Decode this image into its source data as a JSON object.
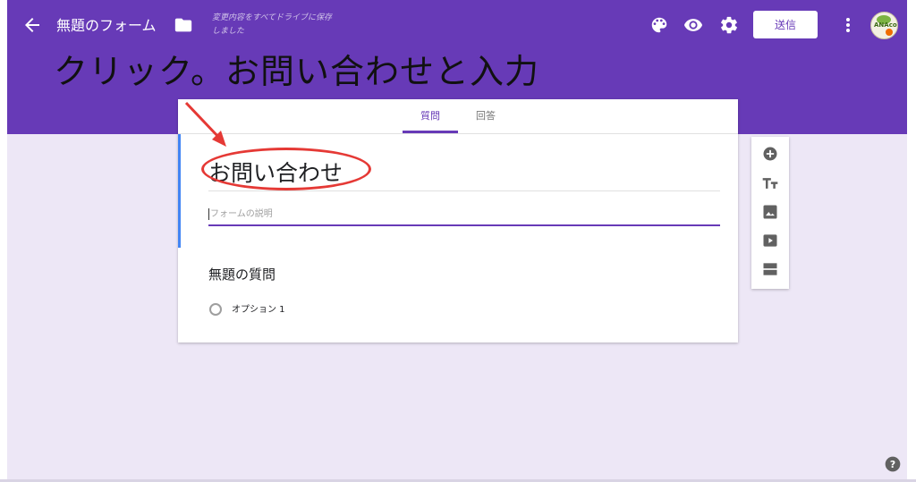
{
  "header": {
    "form_title": "無題のフォーム",
    "save_status": "変更内容をすべてドライブに保存しました",
    "send_label": "送信",
    "annotation": "クリック。お問い合わせと入力",
    "avatar_text": "ANAco"
  },
  "tabs": {
    "questions": "質問",
    "answers": "回答"
  },
  "form": {
    "title": "お問い合わせ",
    "description_placeholder": "フォームの説明"
  },
  "question": {
    "title": "無題の質問",
    "option1": "オプション 1"
  },
  "toolbar": {
    "items": [
      "add-question-icon",
      "add-title-icon",
      "add-image-icon",
      "add-video-icon",
      "add-section-icon"
    ]
  },
  "colors": {
    "theme": "#673ab7",
    "background": "#ede7f6",
    "annotation_red": "#e53935",
    "focus_blue": "#4285f4"
  }
}
